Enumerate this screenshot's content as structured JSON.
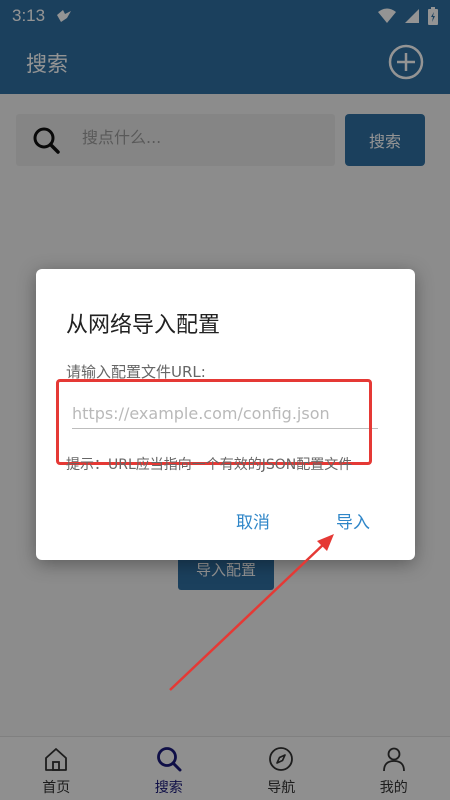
{
  "status_bar": {
    "time": "3:13"
  },
  "app_bar": {
    "title": "搜索"
  },
  "search": {
    "placeholder": "搜点什么...",
    "button_label": "搜索"
  },
  "background": {
    "import_button_label": "导入配置"
  },
  "dialog": {
    "title": "从网络导入配置",
    "prompt": "请输入配置文件URL:",
    "url_placeholder": "https://example.com/config.json",
    "hint": "提示：URL应当指向一个有效的JSON配置文件",
    "cancel_label": "取消",
    "import_label": "导入"
  },
  "bottom_nav": {
    "items": [
      {
        "label": "首页",
        "icon": "home-icon"
      },
      {
        "label": "搜索",
        "icon": "search-icon",
        "active": true
      },
      {
        "label": "导航",
        "icon": "compass-icon"
      },
      {
        "label": "我的",
        "icon": "profile-icon"
      }
    ]
  },
  "colors": {
    "primary": "#2f6fa1",
    "accent_text": "#2f86c8",
    "highlight": "#e53935",
    "active_nav": "#1a1a7a"
  }
}
